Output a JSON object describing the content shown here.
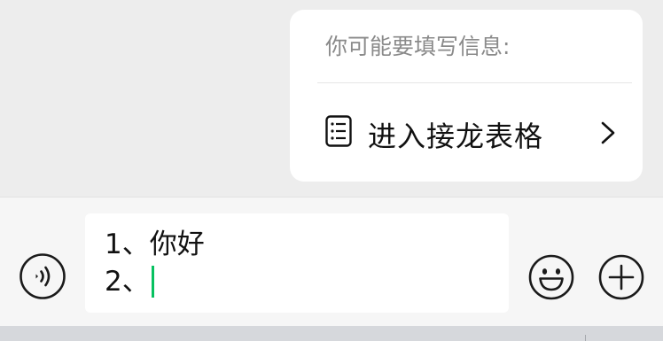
{
  "suggestion_card": {
    "header": "你可能要填写信息:",
    "action_label": "进入接龙表格",
    "action_icon": "form-list-icon",
    "chevron_icon": "chevron-right-icon"
  },
  "input_bar": {
    "voice_icon": "voice-input-icon",
    "text_lines": [
      "1、你好",
      "2、"
    ],
    "emoji_icon": "emoji-icon",
    "more_icon": "plus-icon",
    "caret_color": "#07c160"
  },
  "colors": {
    "background": "#ededed",
    "card": "#ffffff",
    "accent": "#07c160",
    "muted_text": "#8a8a8a"
  }
}
